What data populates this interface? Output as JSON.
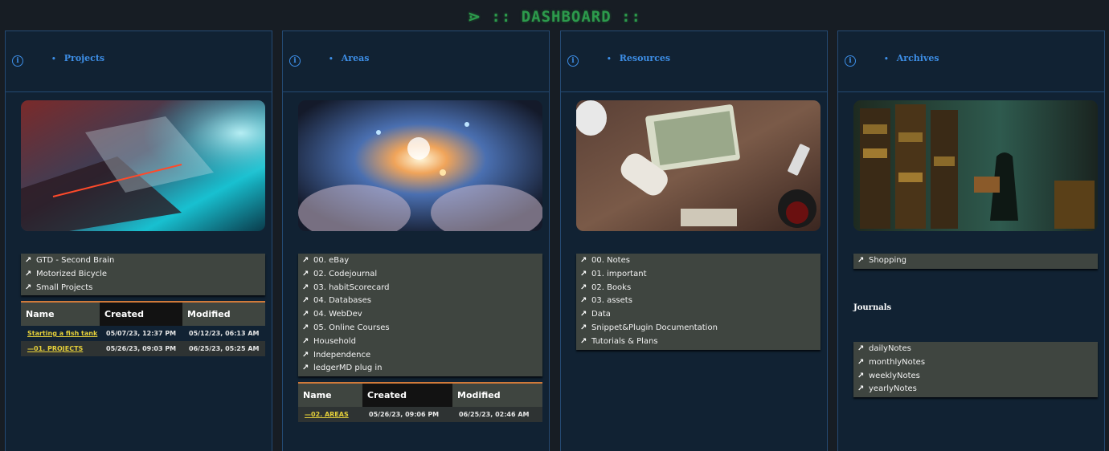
{
  "header": {
    "title": "⋗ :: DASHBOARD ::"
  },
  "columns": [
    {
      "label": "Projects",
      "image": "blueprint-desk",
      "links": [
        "GTD - Second Brain",
        "Motorized Bicycle",
        "Small Projects"
      ],
      "table": {
        "headers": [
          "Name",
          "Created",
          "Modified"
        ],
        "rows": [
          [
            "Starting a fish tank",
            "05/07/23, 12:37 PM",
            "05/12/23, 06:13 AM"
          ],
          [
            "—01. PROJECTS",
            "05/26/23, 09:03 PM",
            "06/25/23, 05:25 AM"
          ]
        ]
      }
    },
    {
      "label": "Areas",
      "image": "glowing-hands",
      "links": [
        "00. eBay",
        "02. Codejournal",
        "03. habitScorecard",
        "04. Databases",
        "04. WebDev",
        "05. Online Courses",
        "Household",
        "Independence",
        "ledgerMD plug in"
      ],
      "table": {
        "headers": [
          "Name",
          "Created",
          "Modified"
        ],
        "rows": [
          [
            "—02. AREAS",
            "05/26/23, 09:06 PM",
            "06/25/23, 02:46 AM"
          ]
        ]
      }
    },
    {
      "label": "Resources",
      "image": "desk-with-money",
      "links": [
        "00. Notes",
        "01. important",
        "02. Books",
        "03. assets",
        "Data",
        "Snippet&Plugin Documentation",
        "Tutorials & Plans"
      ]
    },
    {
      "label": "Archives",
      "image": "library-figure",
      "links": [
        "Shopping"
      ],
      "journals_title": "Journals",
      "journal_links": [
        "dailyNotes",
        "monthlyNotes",
        "weeklyNotes",
        "yearlyNotes"
      ]
    }
  ],
  "icons": {
    "info": "info-icon",
    "link": "arrow-up-right-icon"
  },
  "colors": {
    "accent": "#3d8ee6",
    "title_green": "#2c9a4c",
    "link_yellow": "#e6d03a",
    "table_border": "#d07a3a"
  }
}
